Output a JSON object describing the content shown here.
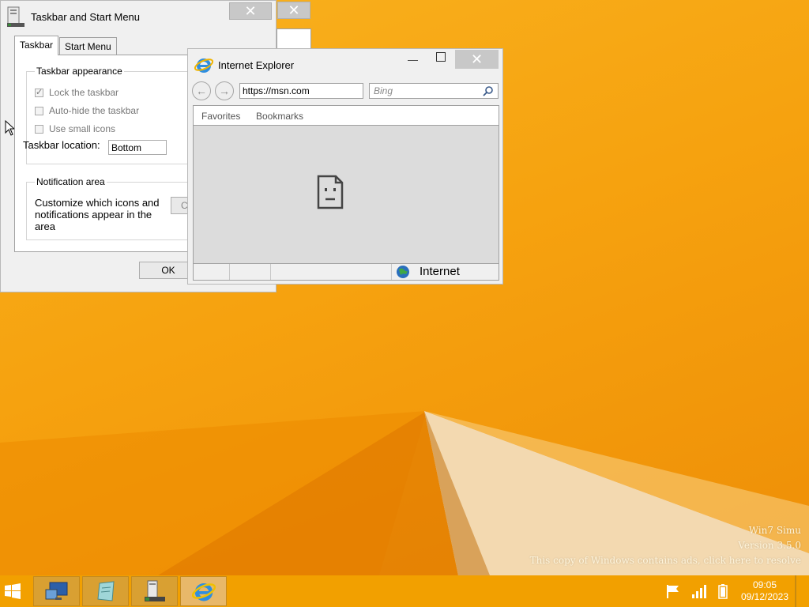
{
  "desktop": {
    "watermark": {
      "line1": "Win7 Simu",
      "line2": "Version 3.5.0",
      "line3": "This copy of Windows contains ads, click here to resolve"
    }
  },
  "taskbar_dialog": {
    "title": "Taskbar and Start Menu",
    "tabs": [
      {
        "label": "Taskbar",
        "active": true
      },
      {
        "label": "Start Menu",
        "active": false
      }
    ],
    "appearance_group": "Taskbar appearance",
    "checkboxes": [
      {
        "label": "Lock the taskbar",
        "checked": true
      },
      {
        "label": "Auto-hide the taskbar",
        "checked": false
      },
      {
        "label": "Use small icons",
        "checked": false
      }
    ],
    "location_label": "Taskbar location:",
    "location_value": "Bottom",
    "notification_group": "Notification area",
    "notification_text": "Customize which icons and notifications appear in the area",
    "customize_button": "C",
    "ok_button": "OK"
  },
  "ie_window": {
    "title": "Internet Explorer",
    "address": "https://msn.com",
    "search_placeholder": "Bing",
    "favbar": [
      "Favorites",
      "Bookmarks"
    ],
    "status_zone": "Internet"
  },
  "taskbar": {
    "items": [
      {
        "name": "computer-app",
        "active": false
      },
      {
        "name": "notepad-app",
        "active": false
      },
      {
        "name": "taskbar-properties-app",
        "active": false
      },
      {
        "name": "internet-explorer-app",
        "active": true
      }
    ],
    "clock_time": "09:05",
    "clock_date": "09/12/2023"
  }
}
